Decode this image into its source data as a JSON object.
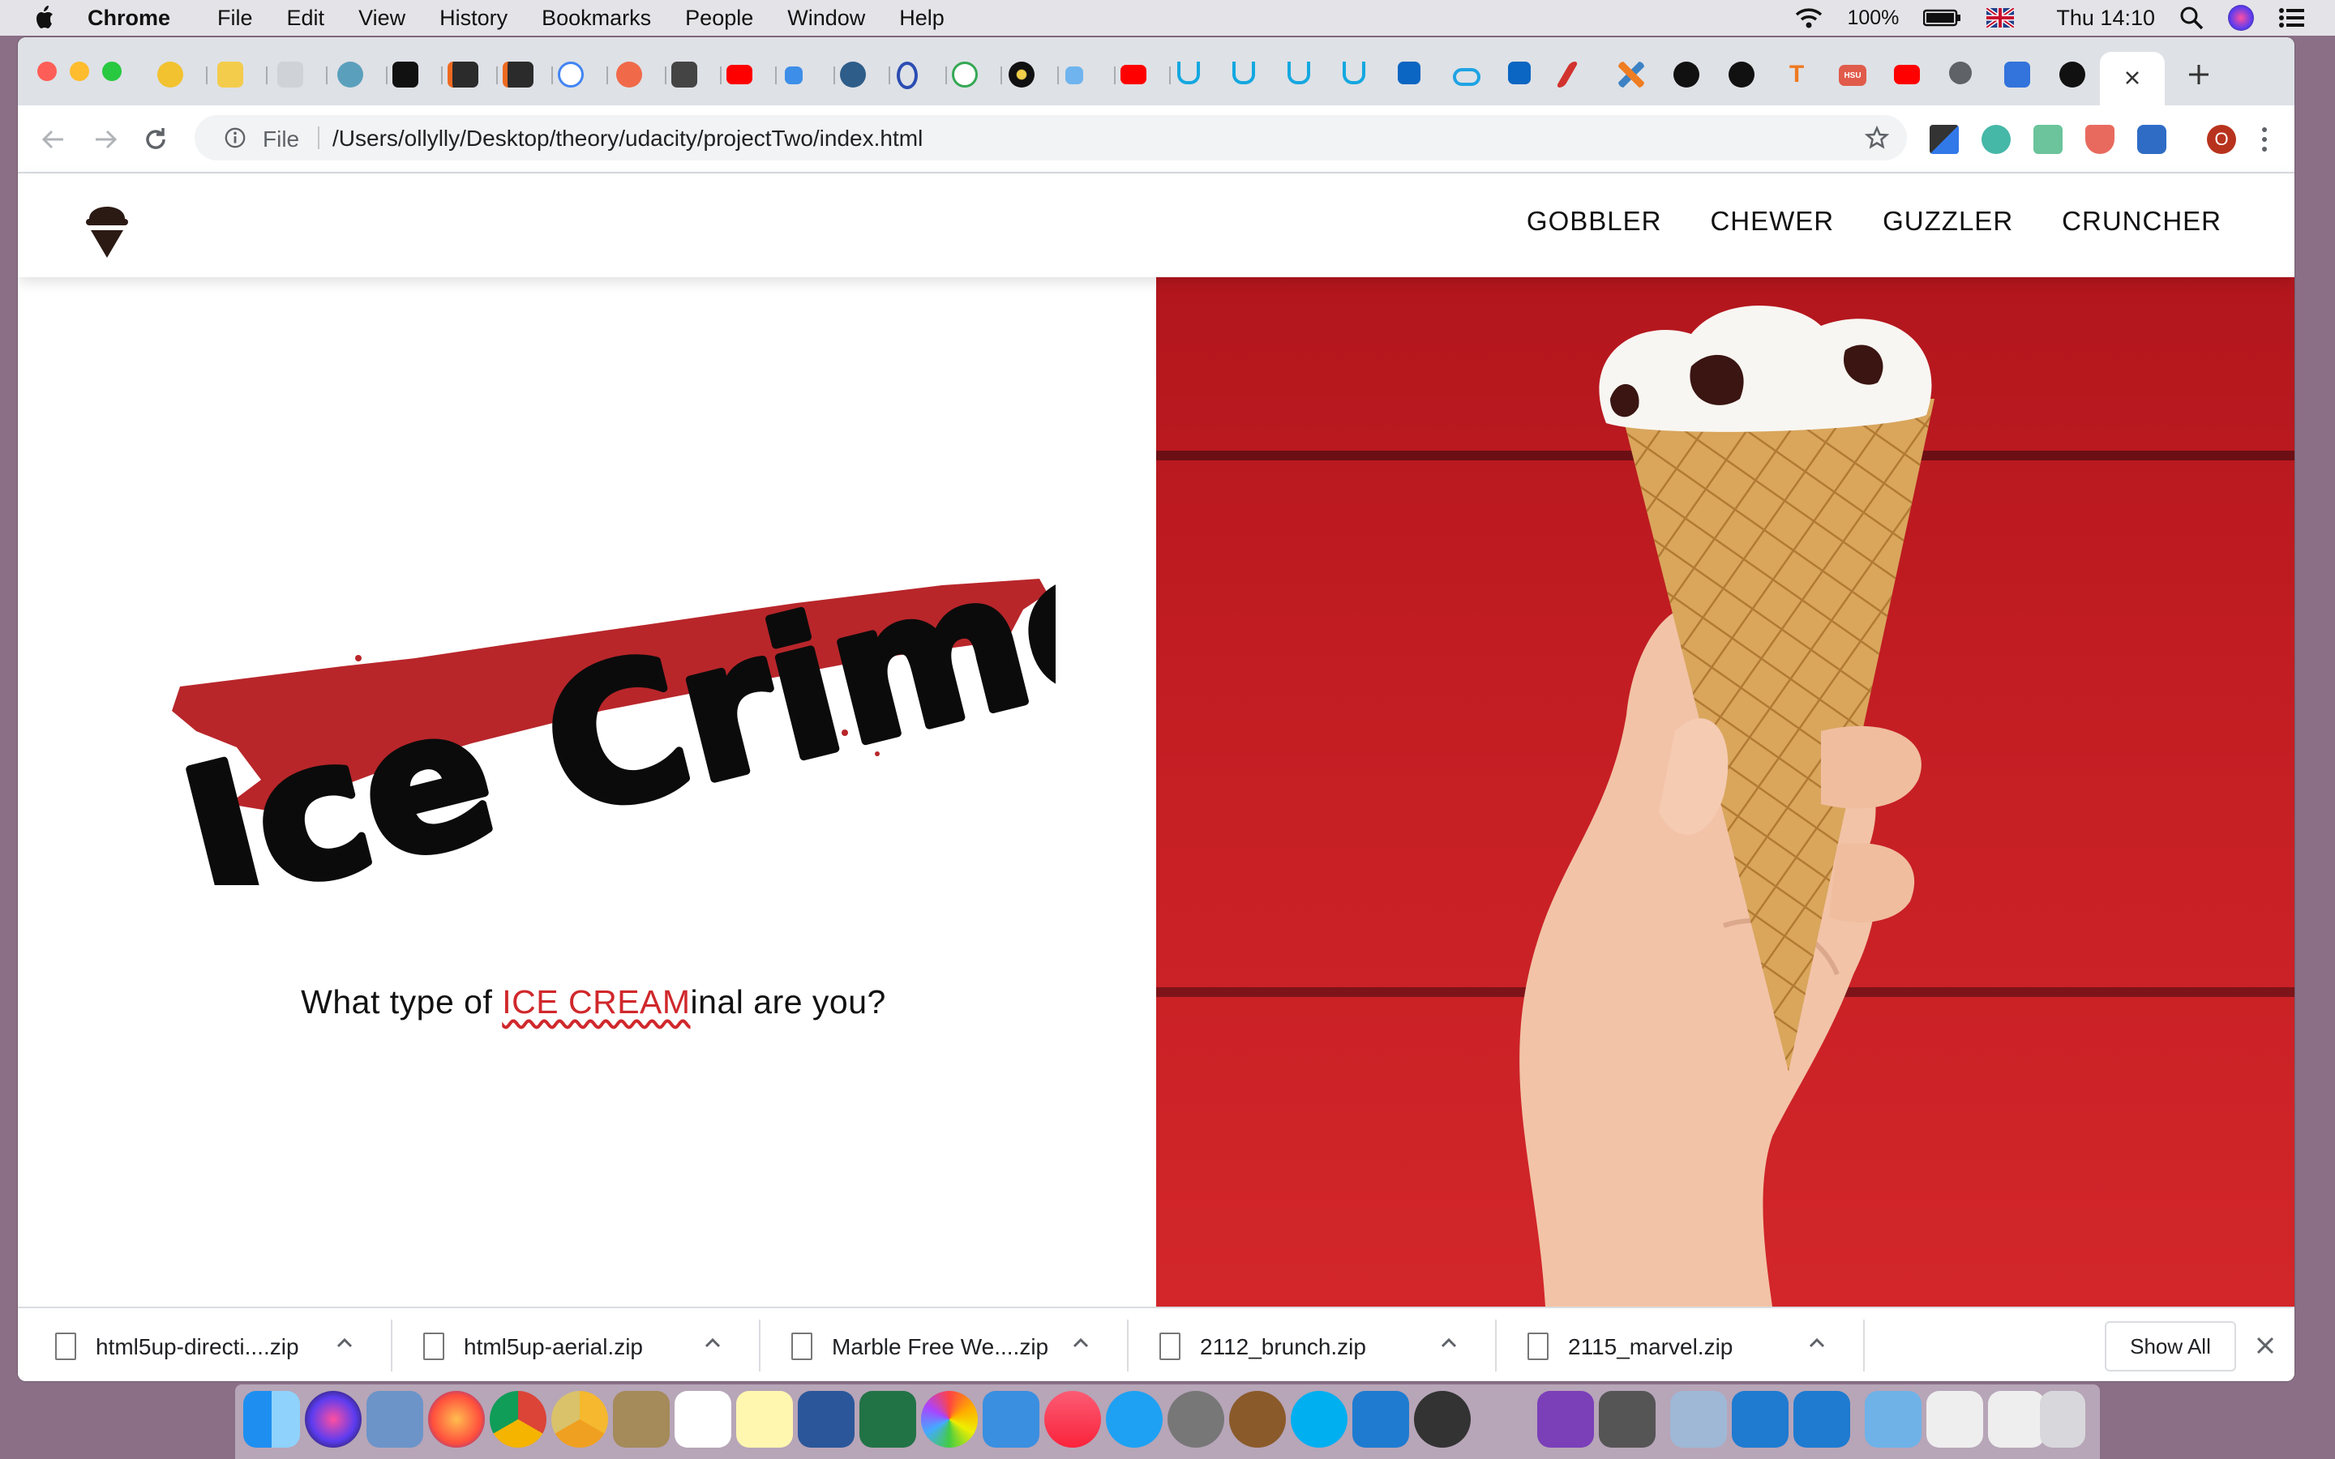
{
  "menubar": {
    "items": [
      "Chrome",
      "File",
      "Edit",
      "View",
      "History",
      "Bookmarks",
      "People",
      "Window",
      "Help"
    ],
    "battery": "100%",
    "clock": "Thu 14:10"
  },
  "browser": {
    "address_scheme": "File",
    "url": "/Users/ollylly/Desktop/theory/udacity/projectTwo/index.html",
    "profile_initial": "O"
  },
  "site": {
    "nav": [
      "GOBBLER",
      "CHEWER",
      "GUZZLER",
      "CRUNCHER"
    ],
    "title": "Ice Crime",
    "tagline": {
      "before": "What type of ",
      "highlight": "ICE CREAM",
      "after": "inal are you?"
    }
  },
  "downloads": {
    "files": [
      "html5up-directi....zip",
      "html5up-aerial.zip",
      "Marble Free We....zip",
      "2112_brunch.zip",
      "2115_marvel.zip"
    ],
    "show_all": "Show All"
  },
  "colors": {
    "accent_red": "#d0282c",
    "hero_bg": "#c61f24",
    "tab_strip": "#dee1e6"
  }
}
